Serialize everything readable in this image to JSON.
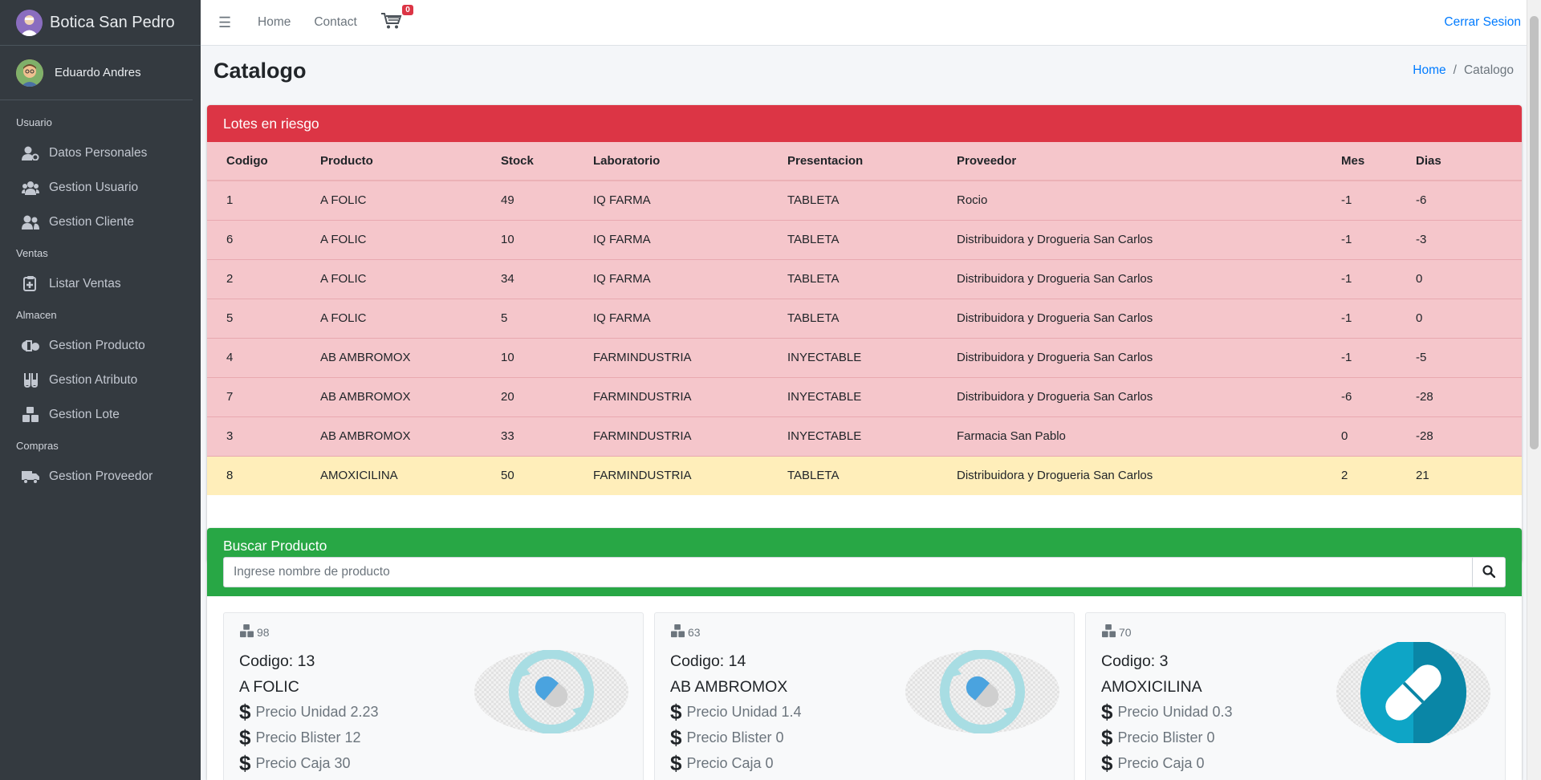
{
  "app": {
    "brand": "Botica San Pedro"
  },
  "user": {
    "name": "Eduardo Andres"
  },
  "sidebar": {
    "sections": [
      {
        "header": "Usuario",
        "items": [
          {
            "label": "Datos Personales",
            "icon": "user-cog-icon"
          },
          {
            "label": "Gestion Usuario",
            "icon": "users-icon"
          },
          {
            "label": "Gestion Cliente",
            "icon": "user-friends-icon"
          }
        ]
      },
      {
        "header": "Ventas",
        "items": [
          {
            "label": "Listar Ventas",
            "icon": "clipboard-plus-icon"
          }
        ]
      },
      {
        "header": "Almacen",
        "items": [
          {
            "label": "Gestion Producto",
            "icon": "pills-icon"
          },
          {
            "label": "Gestion Atributo",
            "icon": "vials-icon"
          },
          {
            "label": "Gestion Lote",
            "icon": "cubes-icon"
          }
        ]
      },
      {
        "header": "Compras",
        "items": [
          {
            "label": "Gestion Proveedor",
            "icon": "truck-icon"
          }
        ]
      }
    ]
  },
  "navbar": {
    "links": [
      "Home",
      "Contact"
    ],
    "cart_count": "0",
    "logout": "Cerrar Sesion"
  },
  "page": {
    "title": "Catalogo",
    "breadcrumb": [
      "Home",
      "Catalogo"
    ]
  },
  "lotes": {
    "title": "Lotes en riesgo",
    "columns": [
      "Codigo",
      "Producto",
      "Stock",
      "Laboratorio",
      "Presentacion",
      "Proveedor",
      "Mes",
      "Dias"
    ],
    "rows": [
      {
        "codigo": "1",
        "producto": "A FOLIC",
        "stock": "49",
        "laboratorio": "IQ FARMA",
        "presentacion": "TABLETA",
        "proveedor": "Rocio",
        "mes": "-1",
        "dias": "-6",
        "status": "danger"
      },
      {
        "codigo": "6",
        "producto": "A FOLIC",
        "stock": "10",
        "laboratorio": "IQ FARMA",
        "presentacion": "TABLETA",
        "proveedor": "Distribuidora y Drogueria San Carlos",
        "mes": "-1",
        "dias": "-3",
        "status": "danger"
      },
      {
        "codigo": "2",
        "producto": "A FOLIC",
        "stock": "34",
        "laboratorio": "IQ FARMA",
        "presentacion": "TABLETA",
        "proveedor": "Distribuidora y Drogueria San Carlos",
        "mes": "-1",
        "dias": "0",
        "status": "danger"
      },
      {
        "codigo": "5",
        "producto": "A FOLIC",
        "stock": "5",
        "laboratorio": "IQ FARMA",
        "presentacion": "TABLETA",
        "proveedor": "Distribuidora y Drogueria San Carlos",
        "mes": "-1",
        "dias": "0",
        "status": "danger"
      },
      {
        "codigo": "4",
        "producto": "AB AMBROMOX",
        "stock": "10",
        "laboratorio": "FARMINDUSTRIA",
        "presentacion": "INYECTABLE",
        "proveedor": "Distribuidora y Drogueria San Carlos",
        "mes": "-1",
        "dias": "-5",
        "status": "danger"
      },
      {
        "codigo": "7",
        "producto": "AB AMBROMOX",
        "stock": "20",
        "laboratorio": "FARMINDUSTRIA",
        "presentacion": "INYECTABLE",
        "proveedor": "Distribuidora y Drogueria San Carlos",
        "mes": "-6",
        "dias": "-28",
        "status": "danger"
      },
      {
        "codigo": "3",
        "producto": "AB AMBROMOX",
        "stock": "33",
        "laboratorio": "FARMINDUSTRIA",
        "presentacion": "INYECTABLE",
        "proveedor": "Farmacia San Pablo",
        "mes": "0",
        "dias": "-28",
        "status": "danger"
      },
      {
        "codigo": "8",
        "producto": "AMOXICILINA",
        "stock": "50",
        "laboratorio": "FARMINDUSTRIA",
        "presentacion": "TABLETA",
        "proveedor": "Distribuidora y Drogueria San Carlos",
        "mes": "2",
        "dias": "21",
        "status": "warning"
      }
    ]
  },
  "search": {
    "title": "Buscar Producto",
    "placeholder": "Ingrese nombre de producto",
    "value": ""
  },
  "products": [
    {
      "stock": "98",
      "codigo": "Codigo: 13",
      "nombre": "A FOLIC",
      "precio_unidad": "Precio Unidad 2.23",
      "precio_blister": "Precio Blister 12",
      "precio_caja": "Precio Caja 30",
      "image": "capsule-refresh-icon"
    },
    {
      "stock": "63",
      "codigo": "Codigo: 14",
      "nombre": "AB AMBROMOX",
      "precio_unidad": "Precio Unidad 1.4",
      "precio_blister": "Precio Blister 0",
      "precio_caja": "Precio Caja 0",
      "image": "capsule-refresh-icon"
    },
    {
      "stock": "70",
      "codigo": "Codigo: 3",
      "nombre": "AMOXICILINA",
      "precio_unidad": "Precio Unidad 0.3",
      "precio_blister": "Precio Blister 0",
      "precio_caja": "Precio Caja 0",
      "image": "pill-circle-icon"
    }
  ],
  "colors": {
    "sidebar_bg": "#343a40",
    "danger": "#dc3545",
    "danger_row": "#f5c6cb",
    "warning_row": "#ffeeba",
    "success": "#28a745",
    "link": "#007bff"
  }
}
